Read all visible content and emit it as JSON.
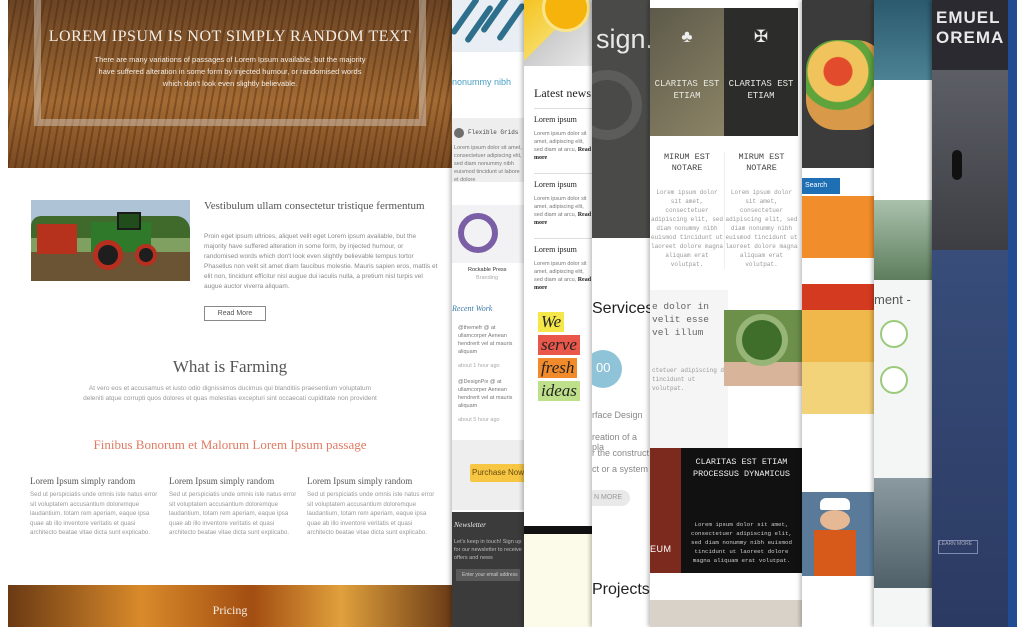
{
  "farming": {
    "hero_title": "LOREM IPSUM IS NOT SIMPLY RANDOM TEXT",
    "hero_text": "There are many variations of passages of Lorem Ipsum available, but the majority have suffered alteration in some form by injected humour, or randomised words which don't look even slightly believable.",
    "article_title": "Vestibulum ullam consectetur tristique fermentum",
    "article_body": "Proin eget ipsum ultrices, aliquet velit eget Lorem ipsum available, but the majority have suffered alteration in some form, by injected humour, or randomised words which don't look even slightly believable tempus tortor Phasellus non velit sit amet diam faucibus molestie. Mauris sapien eros, mattis et elit non, tincidunt efficitur nisl augue dui iaculis nulla, a pretium nisl turpis vel augue auctor viverra aliquam.",
    "read_more": "Read More",
    "section_title": "What is Farming",
    "section_body": "At vero eos et accusamus et iusto odio dignissimos ducimus qui blanditiis praesentium voluptatum deleniti atque corrupti quos dolores et quas molestias excepturi sint occaecati cupiditate non provident",
    "subsection_title": "Finibus Bonorum et Malorum Lorem Ipsum passage",
    "columns": [
      {
        "title": "Lorem Ipsum simply random",
        "body": "Sed ut perspiciatis unde omnis iste natus error sit voluptatem accusantium doloremque laudantium, totam rem aperiam, eaque ipsa quae ab illo inventore veritatis et quasi architecto beatae vitae dicta sunt explicabo."
      },
      {
        "title": "Lorem Ipsum simply random",
        "body": "Sed ut perspiciatis unde omnis iste natus error sit voluptatem accusantium doloremque laudantium, totam rem aperiam, eaque ipsa quae ab illo inventore veritatis et quasi architecto beatae vitae dicta sunt explicabo."
      },
      {
        "title": "Lorem Ipsum simply random",
        "body": "Sed ut perspiciatis unde omnis iste natus error sit voluptatem accusantium doloremque laudantium, totam rem aperiam, eaque ipsa quae ab illo inventore veritatis et quasi architecto beatae vitae dicta sunt explicabo."
      }
    ],
    "pricing": "Pricing"
  },
  "portfolio": {
    "blue_text": "nonummy nibh",
    "feature": "Flexible Grids",
    "feature_text": "Lorem ipsum dolor sit amet, consectetuer adipiscing elit, sed diam nonummy nibh euismod tincidunt ut labore et dolore",
    "caption": "Rockable Press",
    "caption_sub": "Branding",
    "recent_work": "Recent Work",
    "tweets": [
      {
        "text": "@themefr @ at ullamcorper Aenean hendrerit vel at mauris aliquam",
        "time": "about 1 hour ago"
      },
      {
        "text": "@DesignPix @ at ullamcorper Aenean hendrerit vel at mauris aliquam",
        "time": "about 5 hour ago"
      }
    ],
    "purchase": "Purchase Now",
    "newsletter": "Newsletter",
    "newsletter_text": "Let's keep in touch! Sign up for our newsletter to receive offers and news",
    "email_placeholder": "Enter your email address"
  },
  "news": {
    "heading": "Latest news",
    "items": [
      {
        "title": "Lorem ipsum",
        "text": "Lorem ipsum dolor sit amet, adipiscing elit, sed diam at arcu,",
        "more": "Read more"
      },
      {
        "title": "Lorem ipsum",
        "text": "Lorem ipsum dolor sit amet, adipiscing elit, sed diam at arcu,",
        "more": "Read more"
      },
      {
        "title": "Lorem ipsum",
        "text": "Lorem ipsum dolor sit amet, adipiscing elit, sed diam at arcu,",
        "more": "Read more"
      }
    ],
    "poster": [
      "We",
      "serve",
      "fresh",
      "ideas"
    ]
  },
  "design": {
    "headline": "sign.",
    "services": "Services",
    "circle_text": "00",
    "lines": [
      "rface Design",
      "reation of a pla",
      "r the construct",
      "ct or a system"
    ],
    "more": "N MORE",
    "projects": "Projects"
  },
  "claritas": {
    "tiles": [
      {
        "title": "CLARITAS EST ETIAM"
      },
      {
        "title": "CLARITAS EST ETIAM"
      }
    ],
    "columns": [
      {
        "title": "MIRUM EST NOTARE",
        "body": "Lorem ipsum dolor sit amet, consectetuer adipiscing elit, sed diam nonummy nibh euismod tincidunt ut laoreet dolore magna aliquam erat volutpat."
      },
      {
        "title": "MIRUM EST NOTARE",
        "body": "Lorem ipsum dolor sit amet, consectetuer adipiscing elit, sed diam nonummy nibh euismod tincidunt ut laoreet dolore magna aliquam erat volutpat."
      }
    ],
    "mid_large": "e dolor in velit esse vel illum",
    "mid_small": "ctetuer adipiscing d tincidunt ut volutpat.",
    "feature_title": "CLARITAS EST ETIAM PROCESSUS DYNAMICUS",
    "feature_text": "Lorem ipsum dolor sit amet, consectetuer adipiscing elit, sed diam nonummy nibh euismod tincidunt ut laoreet dolore magna aliquam erat volutpat.",
    "red_label": "EUM"
  },
  "food": {
    "search": "Search"
  },
  "nature": {
    "heading": "ment -"
  },
  "dark": {
    "name_1": "EMUEL",
    "name_2": "OREMA",
    "button": "LEARN MORE"
  }
}
